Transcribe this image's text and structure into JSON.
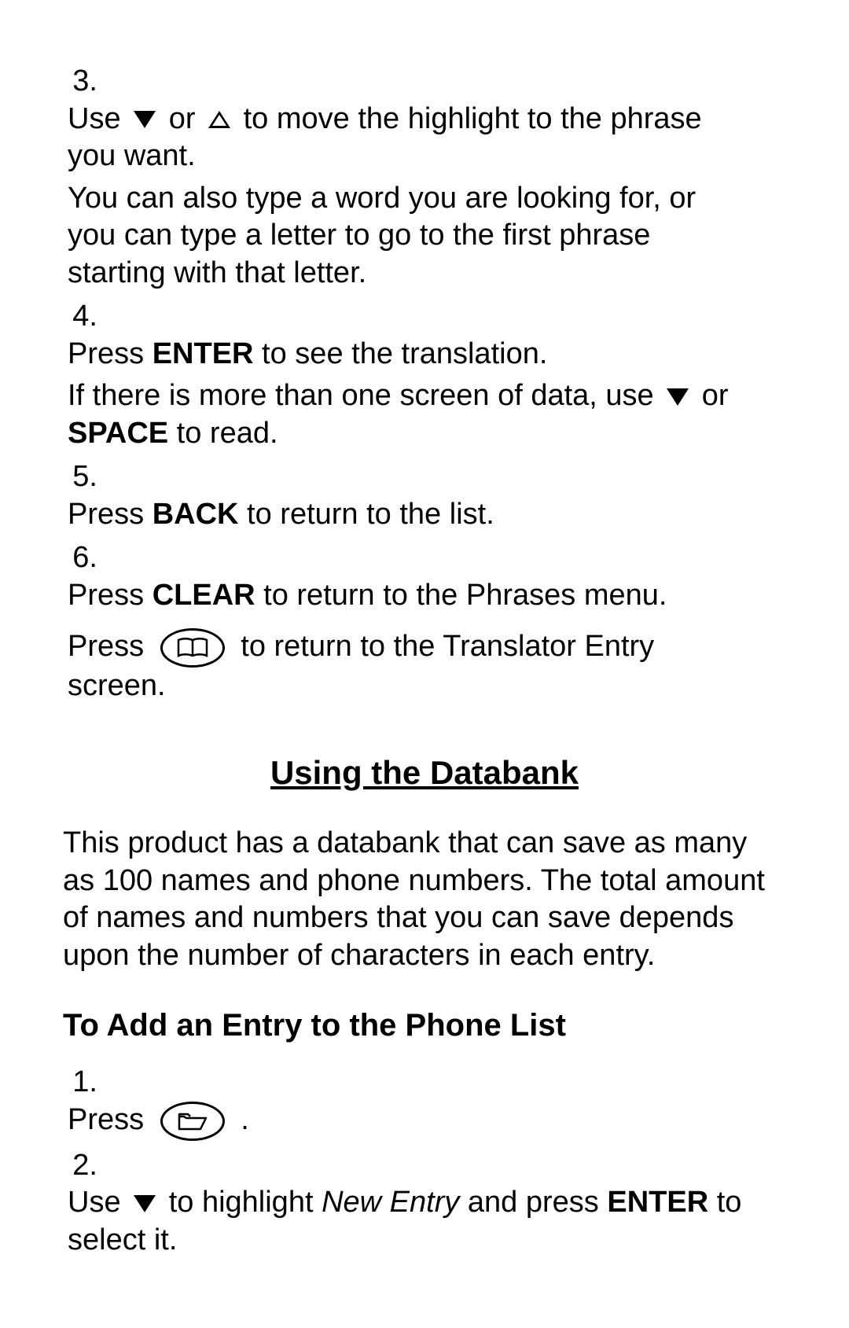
{
  "steps_a": [
    {
      "num": "3.",
      "line1_pre": "Use ",
      "line1_mid": " or ",
      "line1_post": " to move the highlight to the phrase you want.",
      "sub": "You can also type a word you are looking for, or you can type a letter to go to the first phrase starting with that letter."
    },
    {
      "num": "4.",
      "line1_pre": "Press ",
      "key1": "ENTER",
      "line1_post": " to see the translation.",
      "sub_pre": "If there is more than one screen of data, use ",
      "sub_mid": " or ",
      "sub_key": "SPACE",
      "sub_post": " to read."
    },
    {
      "num": "5.",
      "line1_pre": "Press ",
      "key1": "BACK",
      "line1_post": " to return to the list."
    },
    {
      "num": "6.",
      "line1_pre": "Press ",
      "key1": "CLEAR",
      "line1_post": " to return to the Phrases menu.",
      "sub_pre": "Press ",
      "sub_post": " to return to the Translator Entry screen."
    }
  ],
  "section_title": "Using the Databank",
  "section_para": "This product has a databank that can save as many as 100 names and phone numbers. The total amount of names and numbers that you can save depends upon the number of characters in each entry.",
  "subhead": "To Add an Entry to the Phone List",
  "steps_b": [
    {
      "num": "1.",
      "line1_pre": "Press ",
      "line1_post": " ."
    },
    {
      "num": "2.",
      "line1_pre": "Use ",
      "line1_mid": " to highlight ",
      "italic": "New Entry",
      "line1_post2": " and press ",
      "key1": "ENTER",
      "line1_post3": " to select it."
    }
  ]
}
